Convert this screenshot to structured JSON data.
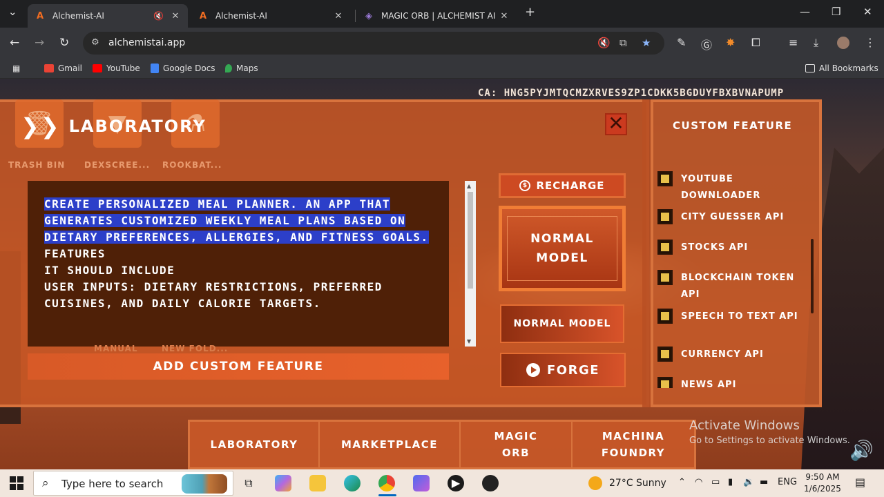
{
  "browser": {
    "tabs": [
      {
        "title": "Alchemist-AI",
        "active": true
      },
      {
        "title": "Alchemist-AI",
        "active": false
      },
      {
        "title": "MAGIC ORB | ALCHEMIST AI DO",
        "active": false
      }
    ],
    "new_tab": "+",
    "url": "alchemistai.app",
    "bookmarks": [
      "Gmail",
      "YouTube",
      "Google Docs",
      "Maps"
    ],
    "all_bookmarks": "All Bookmarks"
  },
  "page": {
    "contract_address": "CA: HNG5PYJMTQCMZXRVES9ZP1CDKK5BGDUYFBXBVNAPUMP",
    "desktop_apps": [
      {
        "label": "TRASH BIN",
        "icon": "trash-icon"
      },
      {
        "label": "DEXSCREE...",
        "icon": "dexscreener-icon"
      },
      {
        "label": "ROOKBAT...",
        "icon": "flask-icon"
      }
    ],
    "ghost_labels": [
      "MANUAL",
      "NEW FOLD..."
    ],
    "laboratory": {
      "title": "LABORATORY",
      "close": "✕",
      "prompt_highlighted": "CREATE PERSONALIZED MEAL PLANNER. AN APP THAT GENERATES CUSTOMIZED WEEKLY MEAL PLANS BASED ON DIETARY PREFERENCES, ALLERGIES, AND FITNESS GOALS.",
      "prompt_rest_lines": [
        "FEATURES",
        "IT SHOULD INCLUDE",
        "USER INPUTS: DIETARY RESTRICTIONS, PREFERRED CUISINES, AND DAILY CALORIE TARGETS."
      ],
      "add_custom_feature": "ADD CUSTOM FEATURE",
      "recharge": "RECHARGE",
      "normal_model_big": "NORMAL MODEL",
      "normal_model_small": "NORMAL MODEL",
      "forge": "FORGE"
    },
    "custom_feature": {
      "title": "CUSTOM FEATURE",
      "items": [
        "YOUTUBE DOWNLOADER",
        "CITY GUESSER API",
        "STOCKS API",
        "BLOCKCHAIN TOKEN API",
        "SPEECH TO TEXT API",
        "CURRENCY API",
        "NEWS API"
      ]
    },
    "bottom_nav": [
      "LABORATORY",
      "MARKETPLACE",
      "MAGIC ORB",
      "MACHINA FOUNDRY"
    ],
    "activate_windows": {
      "title": "Activate Windows",
      "subtitle": "Go to Settings to activate Windows."
    }
  },
  "taskbar": {
    "search_placeholder": "Type here to search",
    "weather": "27°C  Sunny",
    "language": "ENG",
    "time": "9:50 AM",
    "date": "1/6/2025"
  }
}
